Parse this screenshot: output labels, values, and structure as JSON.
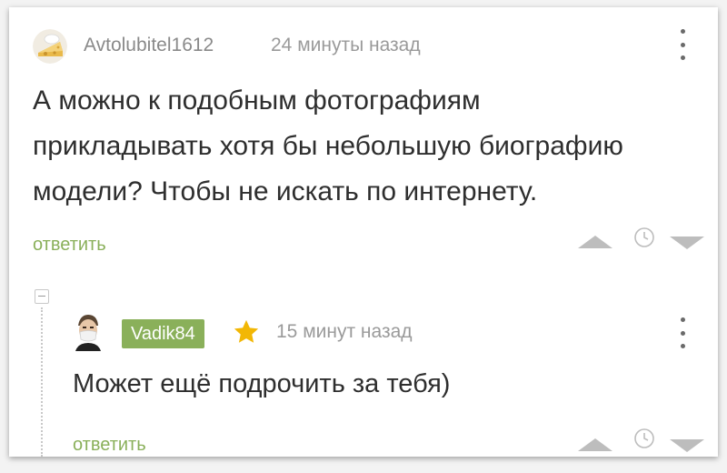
{
  "comment": {
    "author": "Avtolubitel1612",
    "time": "24 минуты назад",
    "text_lines": [
      "А можно к подобным фотографиям",
      "прикладывать хотя бы небольшую биографию",
      "модели? Чтобы не искать по интернету."
    ],
    "reply_label": "ответить",
    "avatar_icon": "cheese-avatar-icon",
    "menu_icon": "more-vertical-icon"
  },
  "reply_comment": {
    "author": "Vadik84",
    "time": "15 минут назад",
    "text": "Может ещё подрочить за тебя)",
    "reply_label": "ответить",
    "badge_icon": "star-icon",
    "avatar_icon": "user-mask-avatar-icon"
  },
  "colors": {
    "accent_green": "#8ab05a",
    "text": "#2e2e2e",
    "muted": "#9a9a9a",
    "vote_gray": "#bdbdbd",
    "star": "#f2b705"
  }
}
